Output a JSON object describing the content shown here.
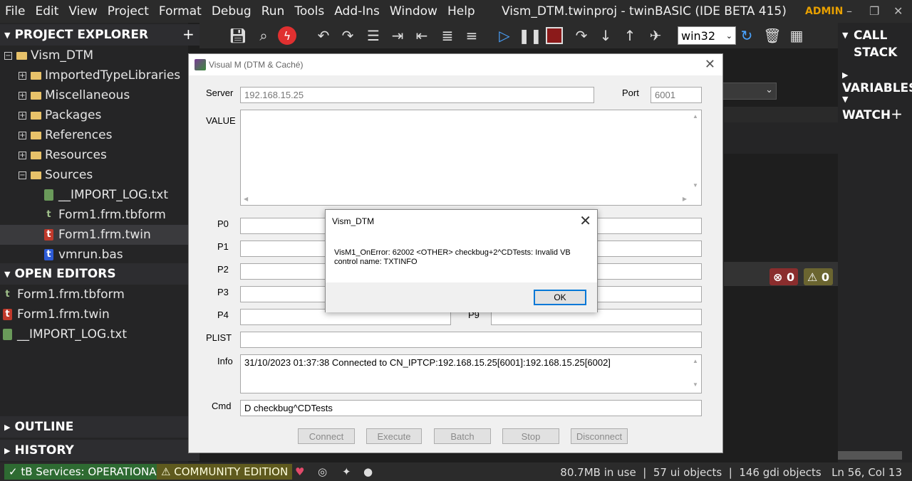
{
  "menu": [
    "File",
    "Edit",
    "View",
    "Project",
    "Format",
    "Debug",
    "Run",
    "Tools",
    "Add-Ins",
    "Window",
    "Help"
  ],
  "window_title": "Vism_DTM.twinproj - twinBASIC (IDE BETA 415)",
  "user": "ADMIN",
  "explorer": {
    "title": "PROJECT EXPLORER",
    "root": "Vism_DTM",
    "folders": [
      "ImportedTypeLibraries",
      "Miscellaneous",
      "Packages",
      "References",
      "Resources",
      "Sources"
    ],
    "files": [
      "__IMPORT_LOG.txt",
      "Form1.frm.tbform",
      "Form1.frm.twin",
      "vmrun.bas"
    ]
  },
  "open_editors": {
    "title": "OPEN EDITORS",
    "files": [
      "Form1.frm.tbform",
      "Form1.frm.twin",
      "__IMPORT_LOG.txt"
    ]
  },
  "outline_title": "OUTLINE",
  "history_title": "HISTORY",
  "toolbar": {
    "platform": "win32"
  },
  "right_panel": {
    "call_stack": "CALL STACK",
    "variables": "VARIABLES",
    "watch": "WATCH"
  },
  "problems": {
    "errors": "0",
    "warnings": "0"
  },
  "status": {
    "services": "tB Services: OPERATIONAL",
    "edition": "COMMUNITY EDITION",
    "memory": "80.7MB in use",
    "ui_objects": "57 ui objects",
    "gdi_objects": "146 gdi objects",
    "position": "Ln 56, Col 13"
  },
  "visualm": {
    "title": "Visual M (DTM & Caché)",
    "server_label": "Server",
    "server": "192.168.15.25",
    "port_label": "Port",
    "port": "6001",
    "value_label": "VALUE",
    "p_labels": [
      "P0",
      "P1",
      "P2",
      "P3",
      "P4"
    ],
    "p9_label": "P9",
    "plist_label": "PLIST",
    "info_label": "Info",
    "info": "31/10/2023 01:37:38 Connected to CN_IPTCP:192.168.15.25[6001]:192.168.15.25[6002]",
    "cmd_label": "Cmd",
    "cmd": "D checkbug^CDTests",
    "buttons": [
      "Connect",
      "Execute",
      "Batch",
      "Stop",
      "Disconnect"
    ]
  },
  "msgbox": {
    "title": "Vism_DTM",
    "text": "VisM1_OnError: 62002 <OTHER> checkbug+2^CDTests: Invalid VB control name: TXTINFO",
    "ok": "OK"
  }
}
